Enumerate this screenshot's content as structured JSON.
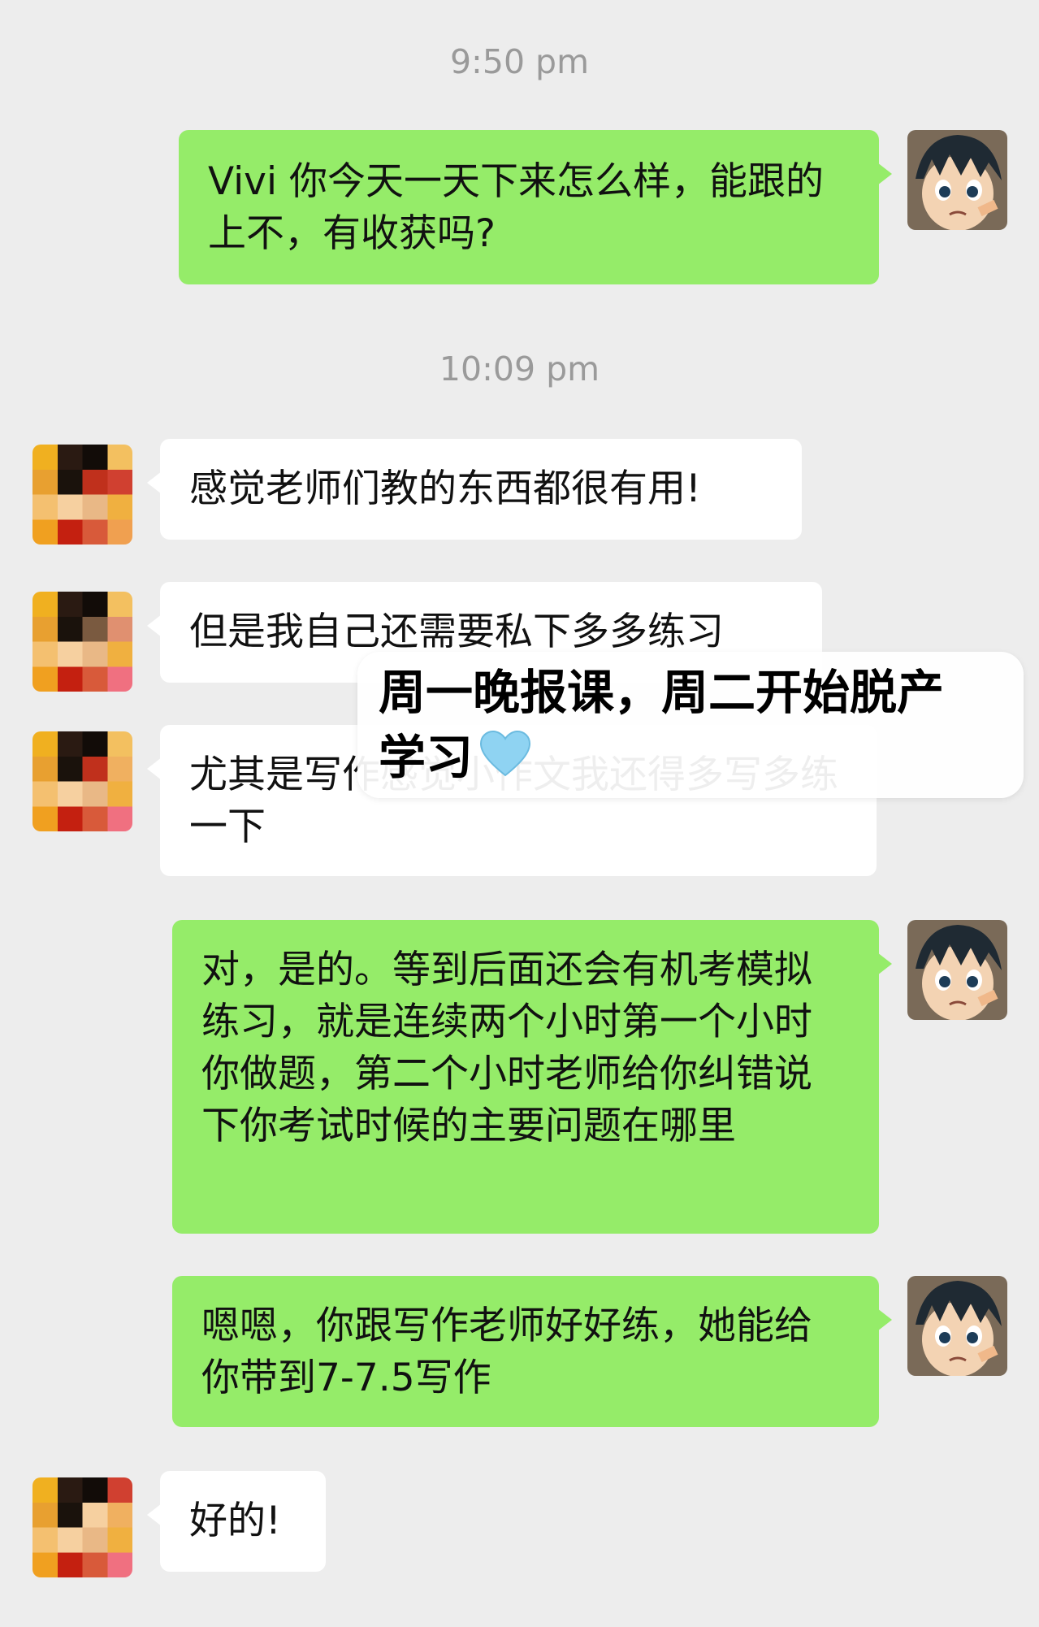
{
  "timestamps": [
    "9:50 pm",
    "10:09 pm"
  ],
  "messages": [
    {
      "side": "me",
      "text": "Vivi 你今天一天下来怎么样，能跟的上不，有收获吗?"
    },
    {
      "side": "other",
      "text": "感觉老师们教的东西都很有用!"
    },
    {
      "side": "other",
      "text": "但是我自己还需要私下多多练习"
    },
    {
      "side": "other",
      "text": "尤其是写作感觉小作文我还得多写多练一下"
    },
    {
      "side": "me",
      "text": "对，是的。等到后面还会有机考模拟练习，就是连续两个小时第一个小时你做题，第二个小时老师给你纠错说下你考试时候的主要问题在哪里"
    },
    {
      "side": "me",
      "text": "嗯嗯，你跟写作老师好好练，她能给你带到7-7.5写作"
    },
    {
      "side": "other",
      "text": "好的!"
    }
  ],
  "overlay": {
    "line1": "周一晚报课，周二开始脱产",
    "line2": "学习",
    "emoji": "light-blue-heart-icon"
  },
  "colors": {
    "background": "#ededed",
    "my_bubble": "#95ec69",
    "other_bubble": "#ffffff",
    "heart": "#8fd3f2"
  }
}
